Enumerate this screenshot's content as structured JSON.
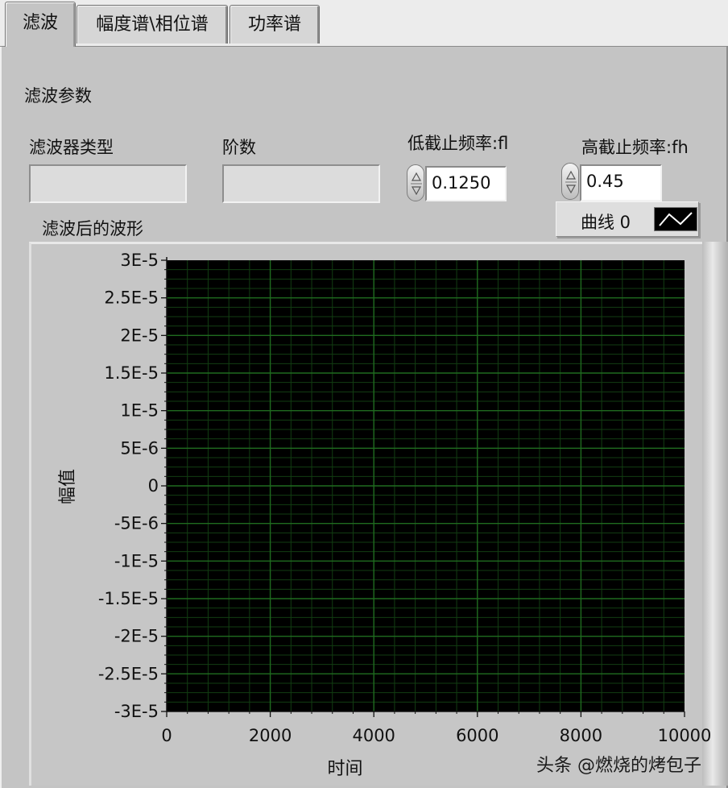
{
  "tabs": [
    {
      "label": "滤波",
      "active": true
    },
    {
      "label": "幅度谱\\相位谱",
      "active": false
    },
    {
      "label": "功率谱",
      "active": false
    }
  ],
  "section_title": "滤波参数",
  "filter_type": {
    "label": "滤波器类型",
    "value": ""
  },
  "order": {
    "label": "阶数",
    "value": ""
  },
  "low_cutoff": {
    "label": "低截止频率:fl",
    "value": "0.1250"
  },
  "high_cutoff": {
    "label": "高截止频率:fh",
    "value": "0.45"
  },
  "graph": {
    "title": "滤波后的波形",
    "legend_label": "曲线 0"
  },
  "chart_data": {
    "type": "line",
    "title": "滤波后的波形",
    "xlabel": "时间",
    "ylabel": "幅值",
    "xlim": [
      0,
      10000
    ],
    "ylim": [
      -3e-05,
      3e-05
    ],
    "x_ticks": [
      "0",
      "2000",
      "4000",
      "6000",
      "8000",
      "10000"
    ],
    "y_ticks": [
      "3E-5",
      "2.5E-5",
      "2E-5",
      "1.5E-5",
      "1E-5",
      "5E-6",
      "0",
      "-5E-6",
      "-1E-5",
      "-1.5E-5",
      "-2E-5",
      "-2.5E-5",
      "-3E-5"
    ],
    "grid": true,
    "series": [
      {
        "name": "曲线 0",
        "x": [],
        "y": []
      }
    ],
    "colors": {
      "plot_bg": "#000000",
      "major_grid": "#1f6b1f",
      "minor_grid": "#123d12"
    }
  },
  "watermark": "头条 @燃烧的烤包子"
}
